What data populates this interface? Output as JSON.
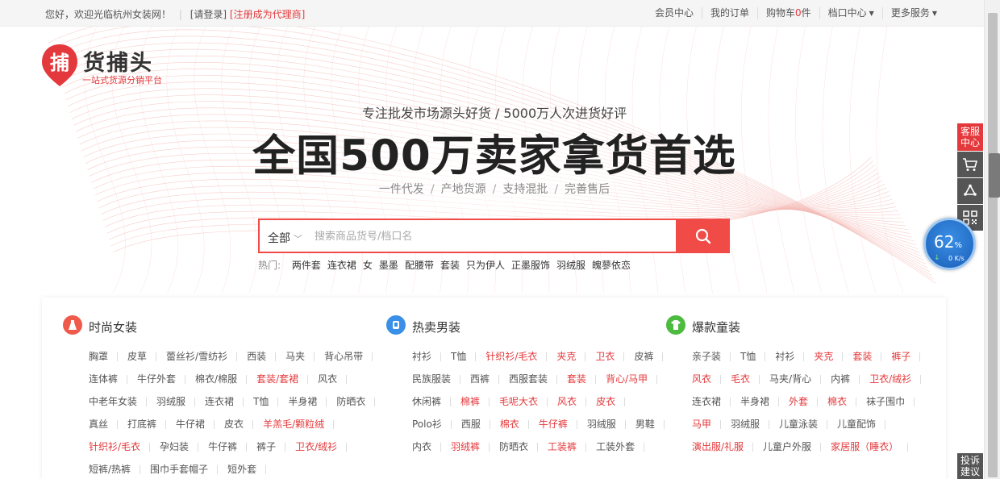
{
  "topbar": {
    "welcome": "您好，欢迎光临杭州女装网！",
    "login": "[请登录]",
    "register": "[注册成为代理商]",
    "member_center": "会员中心",
    "my_orders": "我的订单",
    "cart_label": "购物车",
    "cart_count": "0",
    "cart_unit": "件",
    "stall_center": "档口中心",
    "more_services": "更多服务"
  },
  "logo": {
    "glyph": "捕",
    "brand": "货捕头",
    "slogan": "一站式货源分销平台"
  },
  "hero": {
    "subtitle": "专注批发市场源头好货 / 5000万人次进货好评",
    "headline": "全国500万卖家拿货首选",
    "tags": [
      "一件代发",
      "产地货源",
      "支持混批",
      "完善售后"
    ]
  },
  "search": {
    "category": "全部",
    "placeholder": "搜索商品货号/档口名",
    "value": ""
  },
  "hot": {
    "label": "热门:",
    "keywords": [
      "两件套",
      "连衣裙",
      "女",
      "墨墨",
      "配腰带",
      "套装",
      "只为伊人",
      "正墨服饰",
      "羽绒服",
      "魄蓼依恋"
    ]
  },
  "categories": [
    {
      "title": "时尚女装",
      "icon": "dress-icon",
      "color": "#f05a4a",
      "rows": [
        [
          {
            "t": "胸罩"
          },
          {
            "t": "皮草"
          },
          {
            "t": "蕾丝衫/雪纺衫"
          },
          {
            "t": "西装"
          },
          {
            "t": "马夹"
          },
          {
            "t": "背心吊带"
          }
        ],
        [
          {
            "t": "连体裤"
          },
          {
            "t": "牛仔外套"
          },
          {
            "t": "棉衣/棉服"
          },
          {
            "t": "套装/套裙",
            "red": true
          },
          {
            "t": "风衣"
          }
        ],
        [
          {
            "t": "中老年女装"
          },
          {
            "t": "羽绒服"
          },
          {
            "t": "连衣裙"
          },
          {
            "t": "T恤"
          },
          {
            "t": "半身裙"
          },
          {
            "t": "防晒衣"
          }
        ],
        [
          {
            "t": "真丝"
          },
          {
            "t": "打底裤"
          },
          {
            "t": "牛仔裙"
          },
          {
            "t": "皮衣"
          },
          {
            "t": "羊羔毛/颗粒绒",
            "red": true
          }
        ],
        [
          {
            "t": "针织衫/毛衣",
            "red": true
          },
          {
            "t": "孕妇装"
          },
          {
            "t": "牛仔裤"
          },
          {
            "t": "裤子"
          },
          {
            "t": "卫衣/绒衫",
            "red": true
          }
        ],
        [
          {
            "t": "短裤/热裤"
          },
          {
            "t": "围巾手套帽子"
          },
          {
            "t": "短外套"
          }
        ]
      ]
    },
    {
      "title": "热卖男装",
      "icon": "shirt-icon",
      "color": "#3a8fe6",
      "rows": [
        [
          {
            "t": "衬衫"
          },
          {
            "t": "T恤"
          },
          {
            "t": "针织衫/毛衣",
            "red": true
          },
          {
            "t": "夹克",
            "red": true
          },
          {
            "t": "卫衣",
            "red": true
          },
          {
            "t": "皮裤"
          }
        ],
        [
          {
            "t": "民族服装"
          },
          {
            "t": "西裤"
          },
          {
            "t": "西服套装"
          },
          {
            "t": "套装",
            "red": true
          },
          {
            "t": "背心/马甲",
            "red": true
          }
        ],
        [
          {
            "t": "休闲裤"
          },
          {
            "t": "棉裤",
            "red": true
          },
          {
            "t": "毛呢大衣",
            "red": true
          },
          {
            "t": "风衣",
            "red": true
          },
          {
            "t": "皮衣",
            "red": true
          }
        ],
        [
          {
            "t": "Polo衫"
          },
          {
            "t": "西服"
          },
          {
            "t": "棉衣",
            "red": true
          },
          {
            "t": "牛仔裤",
            "red": true
          },
          {
            "t": "羽绒服"
          },
          {
            "t": "男鞋"
          }
        ],
        [
          {
            "t": "内衣"
          },
          {
            "t": "羽绒裤",
            "red": true
          },
          {
            "t": "防晒衣"
          },
          {
            "t": "工装裤",
            "red": true
          },
          {
            "t": "工装外套"
          }
        ]
      ]
    },
    {
      "title": "爆款童装",
      "icon": "kids-icon",
      "color": "#4cbb3f",
      "rows": [
        [
          {
            "t": "亲子装"
          },
          {
            "t": "T恤"
          },
          {
            "t": "衬衫"
          },
          {
            "t": "夹克",
            "red": true
          },
          {
            "t": "套装",
            "red": true
          },
          {
            "t": "裤子",
            "red": true
          }
        ],
        [
          {
            "t": "风衣",
            "red": true
          },
          {
            "t": "毛衣",
            "red": true
          },
          {
            "t": "马夹/背心"
          },
          {
            "t": "内裤"
          },
          {
            "t": "卫衣/绒衫",
            "red": true
          }
        ],
        [
          {
            "t": "连衣裙"
          },
          {
            "t": "半身裙"
          },
          {
            "t": "外套",
            "red": true
          },
          {
            "t": "棉衣",
            "red": true
          },
          {
            "t": "袜子围巾"
          }
        ],
        [
          {
            "t": "马甲",
            "red": true
          },
          {
            "t": "羽绒服"
          },
          {
            "t": "儿童泳装"
          },
          {
            "t": "儿童配饰"
          }
        ],
        [
          {
            "t": "演出服/礼服",
            "red": true
          },
          {
            "t": "儿童户外服"
          },
          {
            "t": "家居服（睡衣）",
            "red": true
          }
        ]
      ]
    }
  ],
  "sidebar": {
    "service": "客服中心",
    "complaint": "投诉建议",
    "cart_icon": "cart-icon",
    "share_icon": "recycle-icon",
    "qr_icon": "qrcode-icon"
  },
  "speed_widget": {
    "percent": "62",
    "unit": "%",
    "rate": "0 K/s"
  }
}
